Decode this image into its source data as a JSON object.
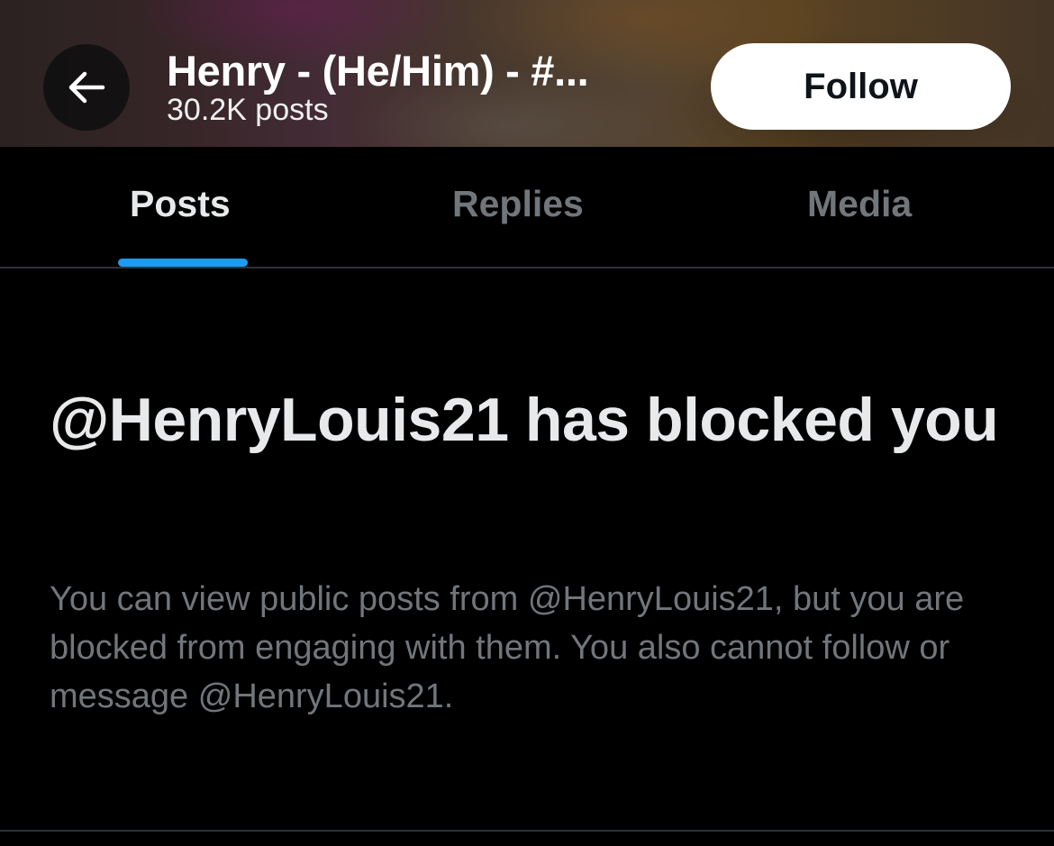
{
  "header": {
    "back_icon": "arrow-left-icon",
    "profile_name": "Henry - (He/Him) - #...",
    "post_count": "30.2K posts",
    "follow_label": "Follow"
  },
  "tabs": [
    {
      "label": "Posts",
      "active": true
    },
    {
      "label": "Replies",
      "active": false
    },
    {
      "label": "Media",
      "active": false
    }
  ],
  "blocked": {
    "heading": "@HenryLouis21 has blocked you",
    "body": "You can view public posts from @HenryLouis21, but you are blocked from engaging with them. You also cannot follow or message @HenryLouis21."
  },
  "colors": {
    "background": "#000000",
    "accent": "#1d9bf0",
    "primary_text": "#e7e9ea",
    "secondary_text": "#71767b",
    "divider": "#2f3336",
    "follow_button_bg": "#ffffff"
  }
}
